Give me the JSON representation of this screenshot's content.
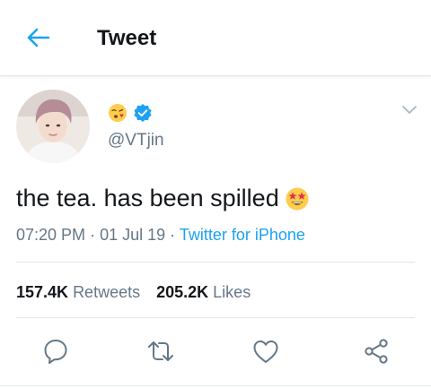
{
  "header": {
    "title": "Tweet"
  },
  "tweet": {
    "handle": "@VTjin",
    "text": "the tea. has been spilled",
    "time": "07:20 PM",
    "date": "01 Jul 19",
    "source": "Twitter for iPhone",
    "retweets_count": "157.4K",
    "retweets_label": "Retweets",
    "likes_count": "205.2K",
    "likes_label": "Likes"
  },
  "icons": {
    "back": "arrow-left-icon",
    "name_emoji": "face-blowing-kiss-emoji",
    "verified": "verified-badge-icon",
    "more": "chevron-down-icon",
    "text_emoji": "star-struck-emoji",
    "reply": "reply-icon",
    "retweet": "retweet-icon",
    "like": "heart-icon",
    "share": "share-icon"
  },
  "colors": {
    "accent": "#1da1f2",
    "text": "#14171a",
    "secondary": "#657786",
    "border": "#e1e8ed"
  }
}
